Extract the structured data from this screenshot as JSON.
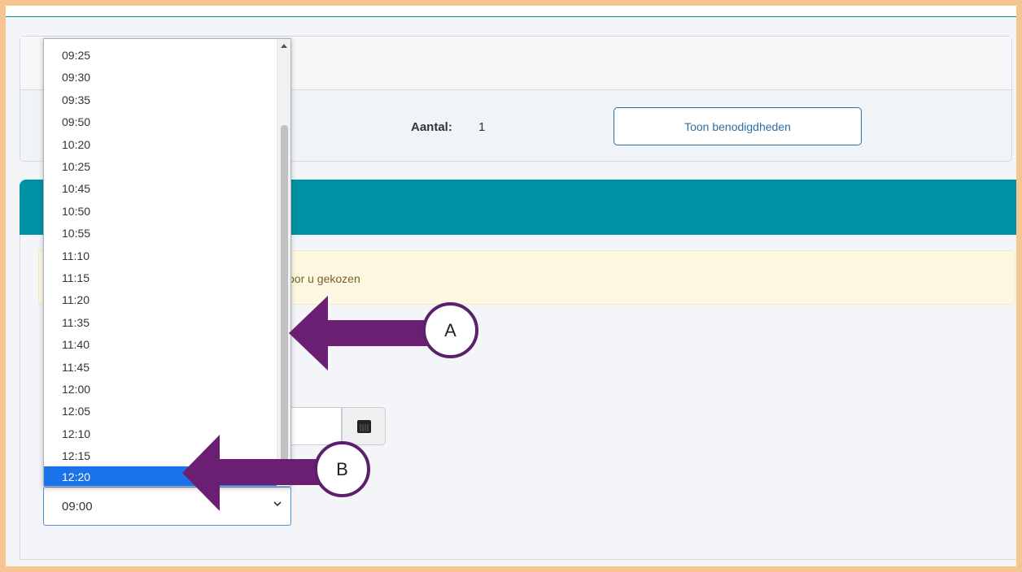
{
  "summary": {
    "aantal_label": "Aantal:",
    "aantal_value": "1",
    "show_button": "Toon benodigdheden"
  },
  "alert": {
    "text": "voor u gekozen"
  },
  "time_select": {
    "value": "09:00",
    "options": [
      "09:25",
      "09:30",
      "09:35",
      "09:50",
      "10:20",
      "10:25",
      "10:45",
      "10:50",
      "10:55",
      "11:10",
      "11:15",
      "11:20",
      "11:35",
      "11:40",
      "11:45",
      "12:00",
      "12:05",
      "12:10",
      "12:15",
      "12:20"
    ],
    "highlighted": "12:20"
  },
  "annotations": {
    "label_a": "A",
    "label_b": "B"
  },
  "colors": {
    "teal": "#0092a4",
    "arrow": "#6b1f73",
    "highlight": "#1a73e8",
    "border": "#f5c68f"
  }
}
